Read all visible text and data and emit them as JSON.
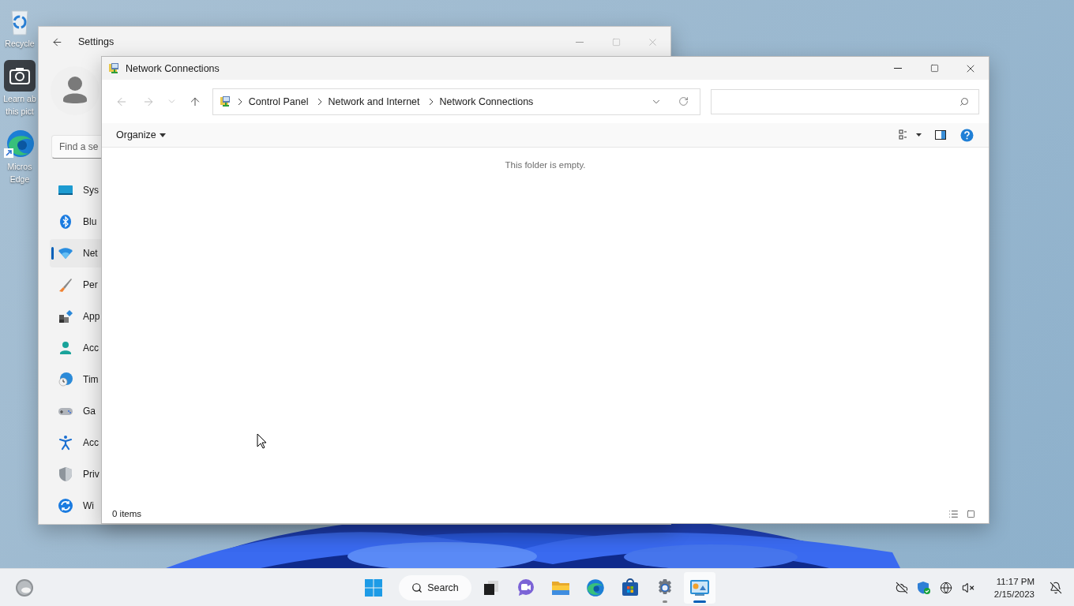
{
  "desktop": {
    "icons": [
      {
        "kind": "recycle",
        "lines": [
          "Recycle"
        ]
      },
      {
        "kind": "camera",
        "lines": [
          "Learn ab",
          "this pict"
        ]
      },
      {
        "kind": "edge",
        "lines": [
          "Micros",
          "Edge"
        ]
      }
    ]
  },
  "settings_window": {
    "title": "Settings",
    "search": {
      "placeholder": "Find a se"
    },
    "nav": [
      {
        "kind": "system",
        "label": "Sys",
        "selected": false
      },
      {
        "kind": "bluetooth",
        "label": "Blu",
        "selected": false
      },
      {
        "kind": "network",
        "label": "Net",
        "selected": true
      },
      {
        "kind": "brush",
        "label": "Per",
        "selected": false
      },
      {
        "kind": "apps",
        "label": "App",
        "selected": false
      },
      {
        "kind": "account",
        "label": "Acc",
        "selected": false
      },
      {
        "kind": "time",
        "label": "Tim",
        "selected": false
      },
      {
        "kind": "gaming",
        "label": "Ga",
        "selected": false
      },
      {
        "kind": "accessibility",
        "label": "Acc",
        "selected": false
      },
      {
        "kind": "privacy",
        "label": "Priv",
        "selected": false
      },
      {
        "kind": "update",
        "label": "Wi",
        "selected": false
      }
    ]
  },
  "explorer": {
    "title": "Network Connections",
    "breadcrumbs": [
      "Control Panel",
      "Network and Internet",
      "Network Connections"
    ],
    "organize": "Organize",
    "empty_message": "This folder is empty.",
    "status": "0 items"
  },
  "taskbar": {
    "search_label": "Search",
    "apps": [
      {
        "kind": "taskview",
        "selected": false,
        "running": false
      },
      {
        "kind": "chat",
        "selected": false,
        "running": false
      },
      {
        "kind": "folder",
        "selected": false,
        "running": false
      },
      {
        "kind": "edge",
        "selected": false,
        "running": false
      },
      {
        "kind": "store",
        "selected": false,
        "running": false
      },
      {
        "kind": "gear",
        "selected": false,
        "running": true
      },
      {
        "kind": "control-panel",
        "selected": true,
        "running": true
      }
    ],
    "time": "11:17 PM",
    "date": "2/15/2023"
  }
}
